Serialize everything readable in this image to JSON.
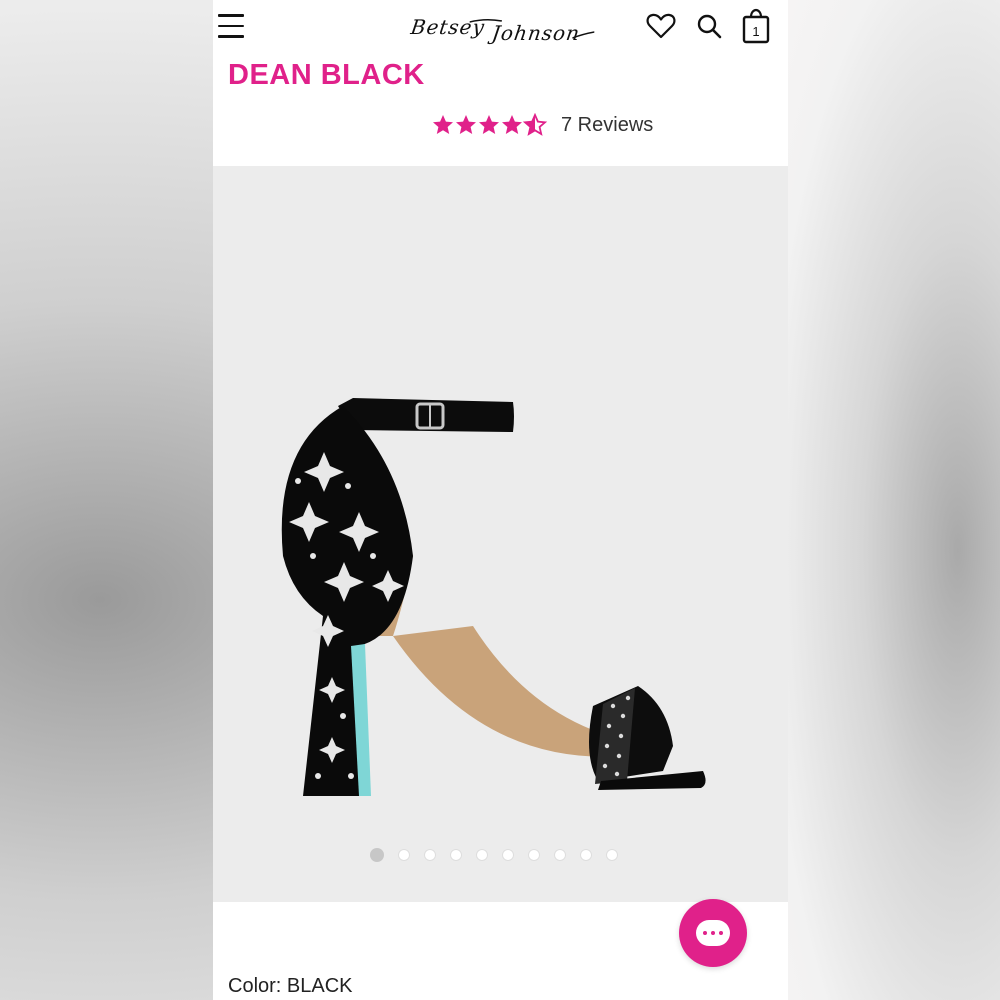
{
  "header": {
    "logo_text": "Betsey Johnson",
    "menu_icon": "hamburger-menu-icon",
    "wishlist_icon": "heart-icon",
    "search_icon": "search-icon",
    "cart_icon": "shopping-bag-icon",
    "cart_count": "1"
  },
  "product": {
    "title": "DEAN BLACK",
    "rating": 4.5,
    "rating_max": 5,
    "reviews_label": "7 Reviews",
    "image_alt": "black rhinestone ankle-strap sandal",
    "carousel_total": 10,
    "carousel_active": 1,
    "color_label": "Color:",
    "color_value": "BLACK"
  },
  "chat": {
    "icon": "chat-bubble-icon"
  },
  "colors": {
    "accent": "#e0218a",
    "image_bg": "#ececec",
    "text": "#222222"
  }
}
